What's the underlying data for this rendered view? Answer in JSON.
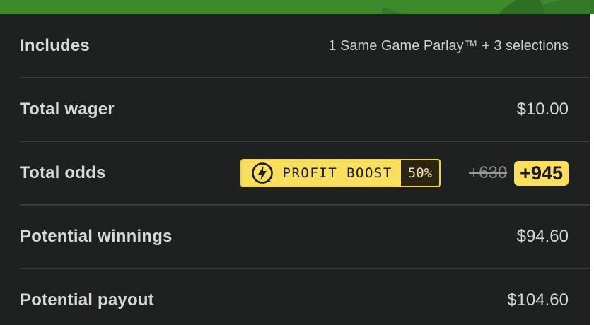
{
  "colors": {
    "banner": "#3e8a2a",
    "panel": "#1f2020",
    "divider": "#3a3b3b",
    "boost_yellow": "#f8df5c",
    "boost_percent_bg": "#2b2410"
  },
  "summary": {
    "includes": {
      "label": "Includes",
      "value": "1 Same Game Parlay™ + 3 selections"
    },
    "total_wager": {
      "label": "Total wager",
      "value": "$10.00"
    },
    "total_odds": {
      "label": "Total odds",
      "boost": {
        "icon": "lightning-boost-icon",
        "label": "PROFIT BOOST",
        "percent": "50%"
      },
      "original_odds": "+630",
      "boosted_odds": "+945"
    },
    "potential_winnings": {
      "label": "Potential winnings",
      "value": "$94.60"
    },
    "potential_payout": {
      "label": "Potential payout",
      "value": "$104.60"
    }
  }
}
